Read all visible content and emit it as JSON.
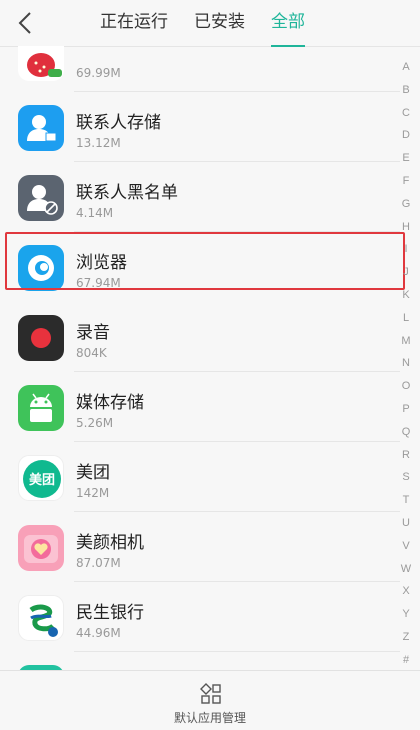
{
  "header": {
    "back_icon": "chevron-left-icon",
    "tabs": [
      {
        "label": "正在运行",
        "active": false
      },
      {
        "label": "已安装",
        "active": false
      },
      {
        "label": "全部",
        "active": true
      }
    ],
    "accent_color": "#1fb59a"
  },
  "apps": [
    {
      "name": "",
      "size": "69.99M",
      "icon": "fruit-app-icon"
    },
    {
      "name": "联系人存储",
      "size": "13.12M",
      "icon": "contacts-storage-icon"
    },
    {
      "name": "联系人黑名单",
      "size": "4.14M",
      "icon": "contacts-blacklist-icon"
    },
    {
      "name": "浏览器",
      "size": "67.94M",
      "icon": "browser-icon"
    },
    {
      "name": "录音",
      "size": "804K",
      "icon": "recorder-icon"
    },
    {
      "name": "媒体存储",
      "size": "5.26M",
      "icon": "android-icon"
    },
    {
      "name": "美团",
      "size": "142M",
      "icon": "meituan-icon"
    },
    {
      "name": "美颜相机",
      "size": "87.07M",
      "icon": "beauty-camera-icon"
    },
    {
      "name": "民生银行",
      "size": "44.96M",
      "icon": "minsheng-bank-icon"
    },
    {
      "name": "",
      "size": "",
      "icon": "teal-app-icon"
    }
  ],
  "index_letters": [
    "A",
    "B",
    "C",
    "D",
    "E",
    "F",
    "G",
    "H",
    "I",
    "J",
    "K",
    "L",
    "M",
    "N",
    "O",
    "P",
    "Q",
    "R",
    "S",
    "T",
    "U",
    "V",
    "W",
    "X",
    "Y",
    "Z",
    "#"
  ],
  "highlight_color": "#e0383e",
  "bottom": {
    "icon": "default-apps-icon",
    "label": "默认应用管理"
  }
}
